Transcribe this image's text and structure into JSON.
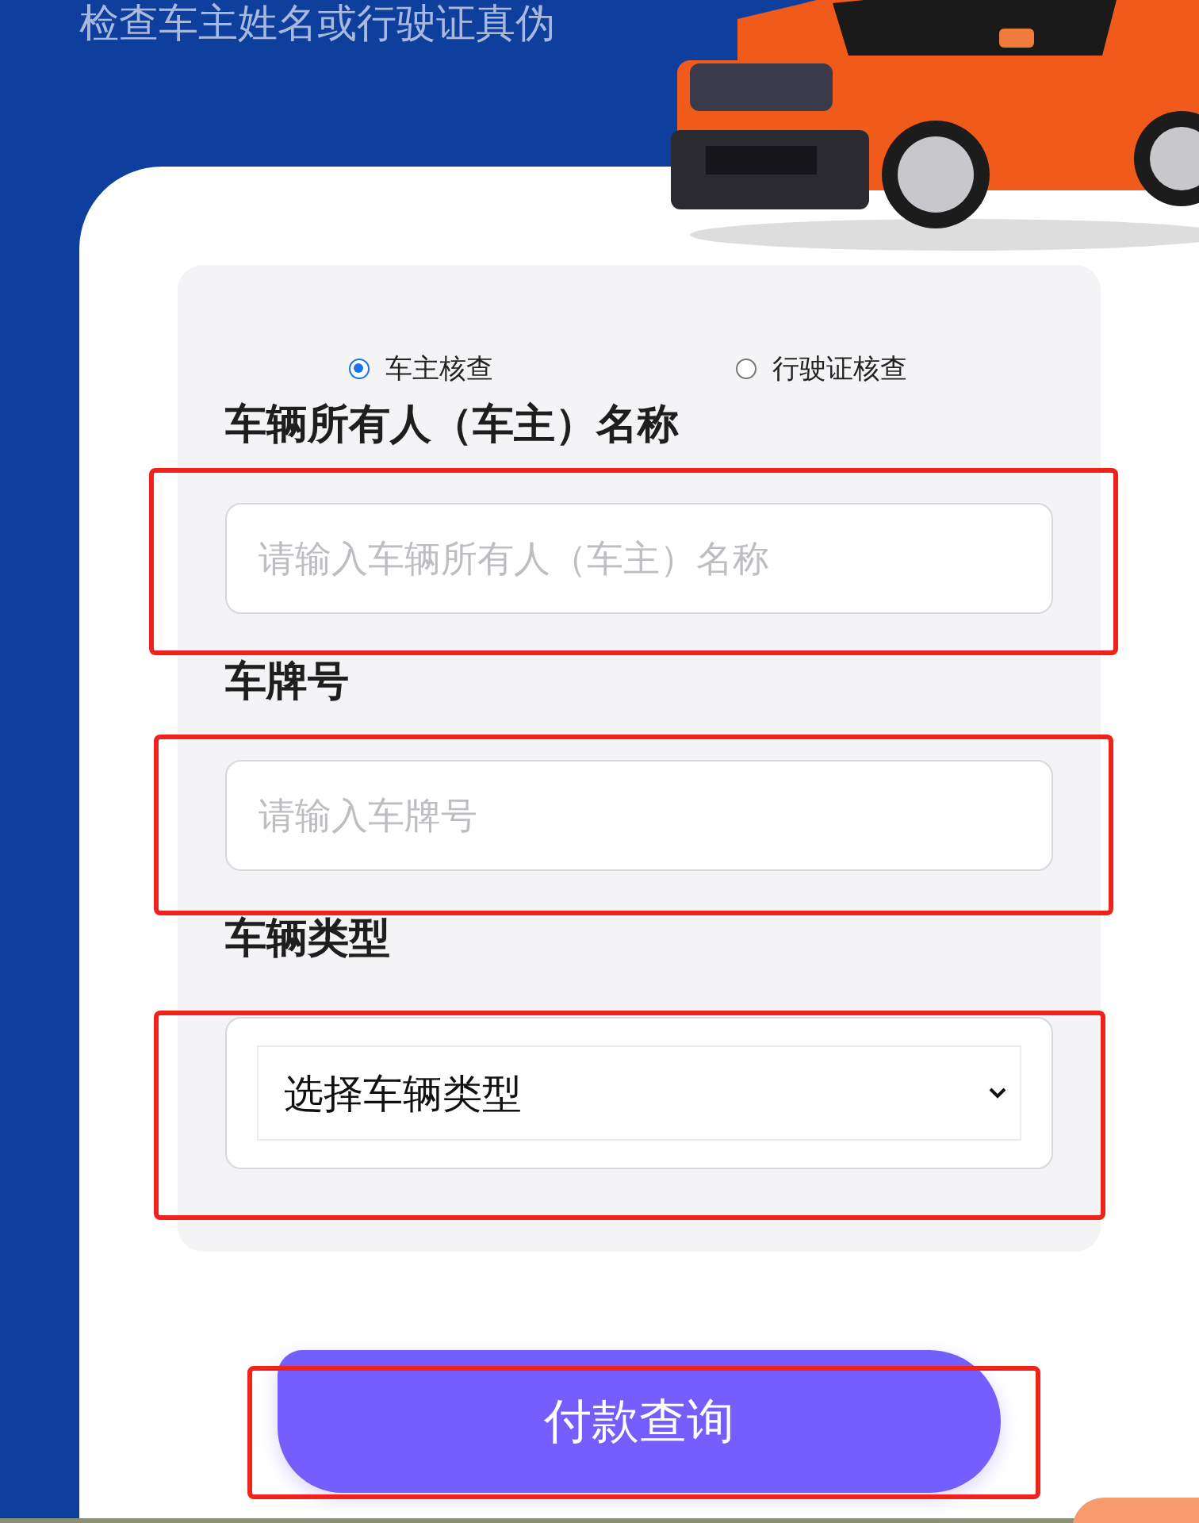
{
  "header": {
    "title": "检查车主姓名或行驶证真伪"
  },
  "check_modes": [
    {
      "label": "车主核查",
      "selected": true
    },
    {
      "label": "行驶证核查",
      "selected": false
    }
  ],
  "fields": [
    {
      "kind": "text",
      "label": "车辆所有人（车主）名称",
      "placeholder": "请输入车辆所有人（车主）名称",
      "highlighted": true
    },
    {
      "kind": "text",
      "label": "车牌号",
      "placeholder": "请输入车牌号",
      "highlighted": true
    },
    {
      "kind": "select",
      "label": "车辆类型",
      "value": "选择车辆类型",
      "highlighted": true
    }
  ],
  "submit_button": {
    "label": "付款查询",
    "highlighted": true
  }
}
